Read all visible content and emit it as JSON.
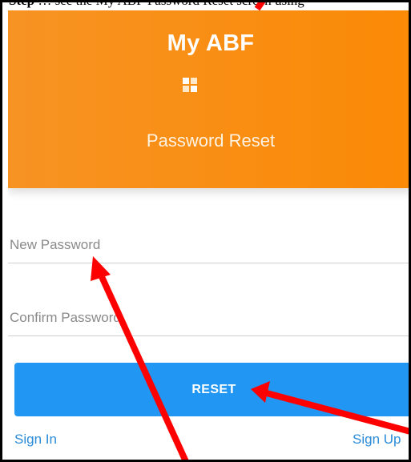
{
  "caption": {
    "bold_text": "Step",
    "text": "… see the My ABF Password Reset screen using"
  },
  "header": {
    "app_title": "My ABF",
    "page_title": "Password Reset",
    "logo_icon": "grid-logo-icon",
    "background_color": "#f98e13"
  },
  "form": {
    "new_password": {
      "placeholder": "New Password",
      "value": ""
    },
    "confirm_password": {
      "placeholder": "Confirm Password",
      "value": ""
    },
    "reset_label": "RESET",
    "button_color": "#2196f3"
  },
  "links": {
    "sign_in": "Sign In",
    "sign_up": "Sign Up"
  },
  "annotations": {
    "arrow_color": "#ff0000",
    "arrow_targets": [
      "header-title",
      "new-password-field",
      "reset-button"
    ]
  }
}
